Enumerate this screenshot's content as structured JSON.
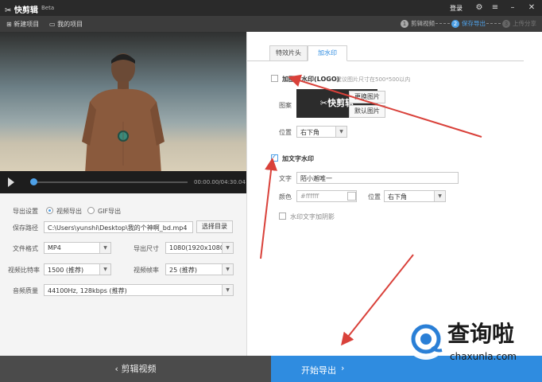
{
  "titlebar": {
    "app_name": "快剪辑",
    "beta": "Beta",
    "login": "登录"
  },
  "toolbar": {
    "new_project": "新建项目",
    "my_projects": "我的项目"
  },
  "steps": [
    {
      "num": "1",
      "label": "剪辑视频"
    },
    {
      "num": "2",
      "label": "保存导出"
    },
    {
      "num": "3",
      "label": "上传分享"
    }
  ],
  "player": {
    "time": "00:00.00/04:30.04",
    "progress": 0.01
  },
  "export": {
    "settings_label": "导出设置",
    "video_export": "视频导出",
    "gif_export": "GIF导出",
    "save_path_label": "保存路径",
    "save_path": "C:\\Users\\yunshi\\Desktop\\我的个神啊_bd.mp4",
    "choose_dir": "选择目录",
    "format_label": "文件格式",
    "format": "MP4",
    "size_label": "导出尺寸",
    "size": "1080(1920x1080)",
    "bitrate_label": "视频比特率",
    "bitrate": "1500 (推荐)",
    "fps_label": "视频帧率",
    "fps": "25 (推荐)",
    "audio_label": "音频质量",
    "audio": "44100Hz, 128kbps (推荐)"
  },
  "tabs": [
    {
      "label": "特效片头"
    },
    {
      "label": "加水印"
    }
  ],
  "image_watermark": {
    "checkbox_label": "加图片水印(LOGO)",
    "hint": "建议图片尺寸在500*500以内",
    "image_label": "图案",
    "preview_text": "快剪辑",
    "change_image": "更换图片",
    "default_image": "默认图片",
    "position_label": "位置",
    "position": "右下角"
  },
  "text_watermark": {
    "checkbox_label": "加文字水印",
    "text_label": "文字",
    "text": "陌小邂唯一",
    "color_label": "颜色",
    "color": "#ffffff",
    "position_label": "位置",
    "position": "右下角",
    "shadow_label": "水印文字加阴影"
  },
  "bottom": {
    "edit_video": "剪辑视频",
    "start_export": "开始导出"
  },
  "site_watermark": {
    "cn": "查询啦",
    "url": "chaxunla.com"
  },
  "colors": {
    "accent": "#2f8ce0",
    "arrow": "#d9413a"
  }
}
